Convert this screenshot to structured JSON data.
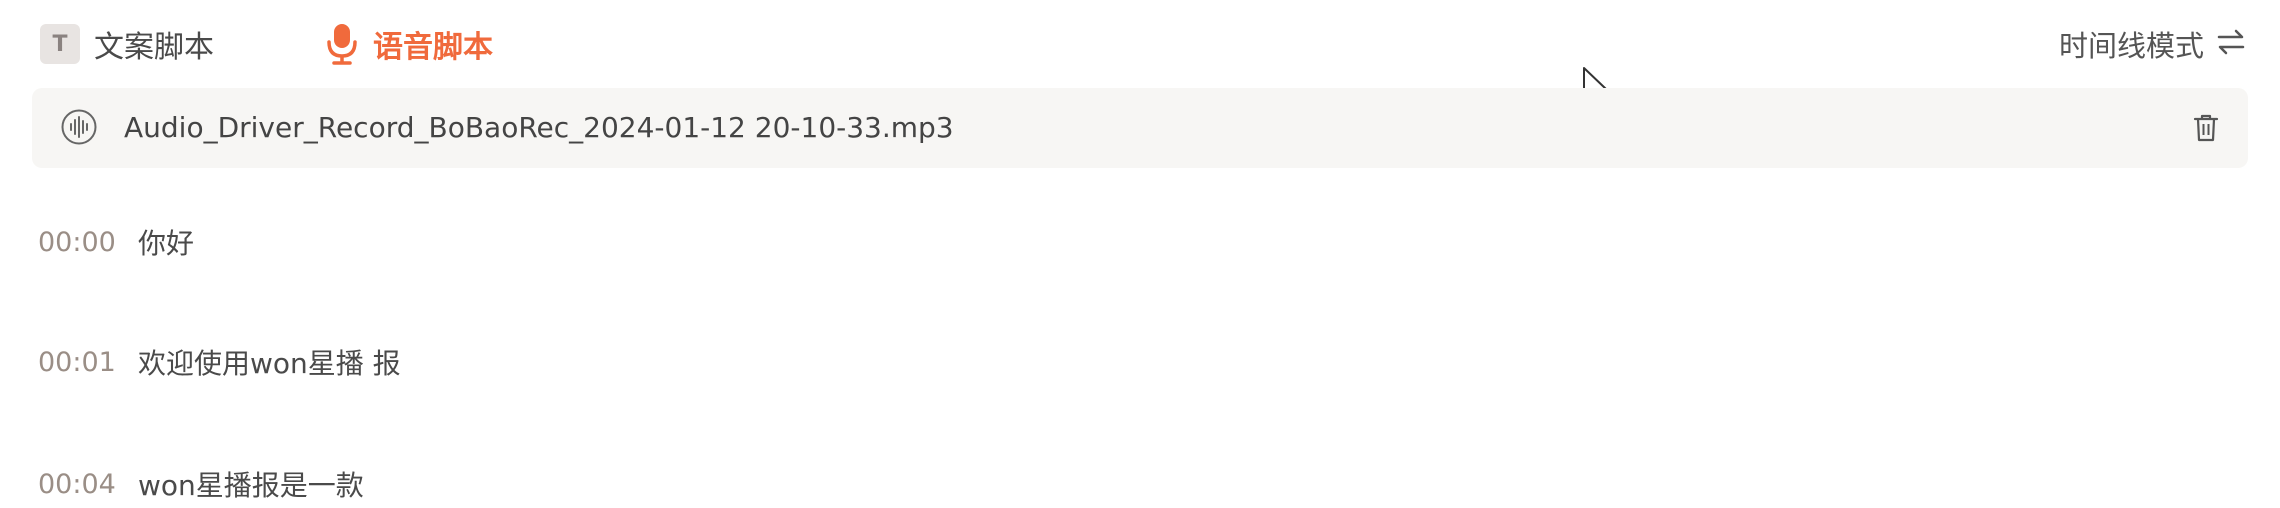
{
  "tabs": {
    "text_script": {
      "badge": "T",
      "label": "文案脚本"
    },
    "voice_script": {
      "label": "语音脚本",
      "active": true
    }
  },
  "mode": {
    "label": "时间线模式"
  },
  "file": {
    "name": "Audio_Driver_Record_BoBaoRec_2024-01-12 20-10-33.mp3"
  },
  "transcript": [
    {
      "time": "00:00",
      "text": "你好"
    },
    {
      "time": "00:01",
      "text": "欢迎使用won星播 报"
    },
    {
      "time": "00:04",
      "text": "won星播报是一款"
    }
  ],
  "colors": {
    "accent": "#f06a3c",
    "timestamp": "#9a8e86",
    "file_bar_bg": "#f7f6f4"
  },
  "icons": [
    "microphone-icon",
    "audio-wave-icon",
    "trash-icon",
    "swap-arrows-icon",
    "mouse-cursor-icon"
  ]
}
